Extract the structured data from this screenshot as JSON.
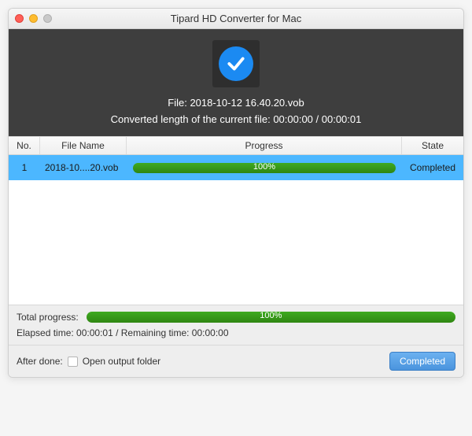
{
  "window": {
    "title": "Tipard HD Converter for Mac"
  },
  "header": {
    "file_label_prefix": "File: ",
    "file_name": "2018-10-12 16.40.20.vob",
    "converted_prefix": "Converted length of the current file: ",
    "converted_value": "00:00:00 / 00:00:01"
  },
  "table": {
    "headers": {
      "no": "No.",
      "name": "File Name",
      "progress": "Progress",
      "state": "State"
    },
    "rows": [
      {
        "no": "1",
        "name": "2018-10....20.vob",
        "percent": "100%",
        "state": "Completed"
      }
    ]
  },
  "footer": {
    "total_label": "Total progress:",
    "total_percent": "100%",
    "time_line": "Elapsed time: 00:00:01 / Remaining time: 00:00:00",
    "after_done_label": "After done:",
    "open_folder_label": "Open output folder",
    "button": "Completed"
  }
}
